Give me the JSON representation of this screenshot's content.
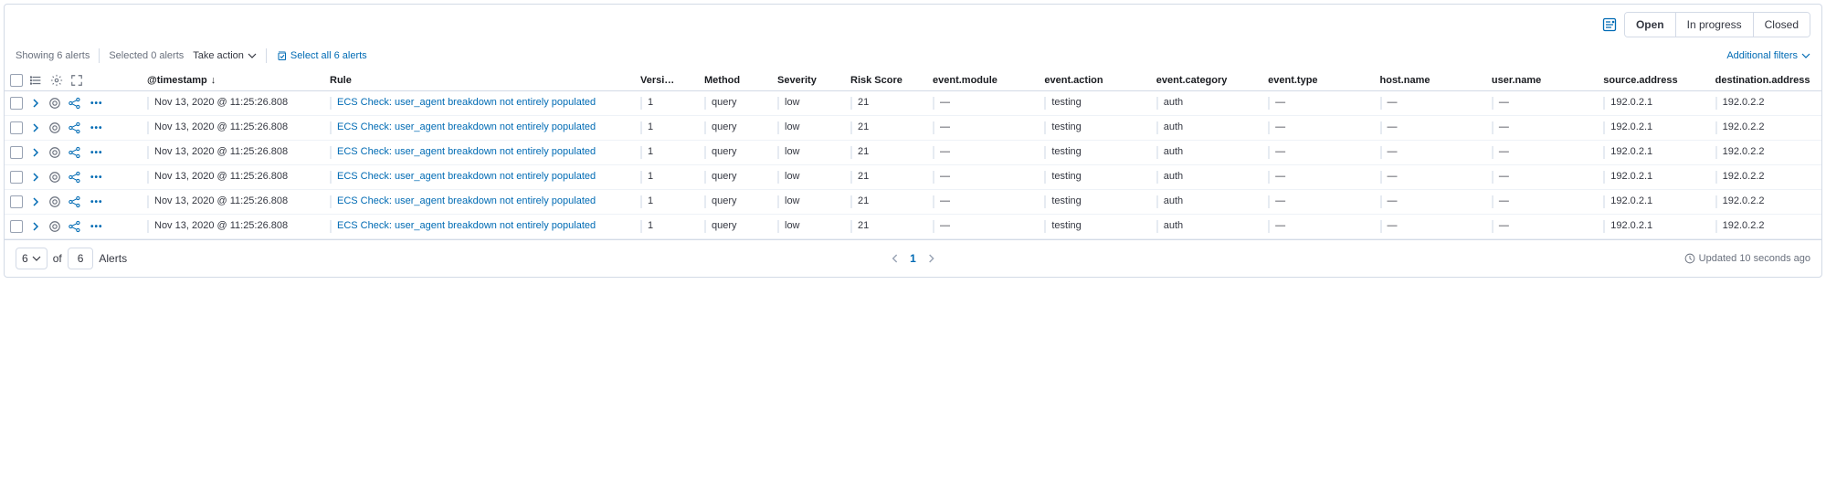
{
  "topbar": {
    "status_open": "Open",
    "status_inprogress": "In progress",
    "status_closed": "Closed"
  },
  "toolbar": {
    "showing": "Showing 6 alerts",
    "selected": "Selected 0 alerts",
    "take_action": "Take action",
    "select_all": "Select all 6 alerts",
    "additional_filters": "Additional filters"
  },
  "columns": {
    "timestamp": "@timestamp",
    "rule": "Rule",
    "version": "Versi…",
    "method": "Method",
    "severity": "Severity",
    "risk_score": "Risk Score",
    "event_module": "event.module",
    "event_action": "event.action",
    "event_category": "event.category",
    "event_type": "event.type",
    "host_name": "host.name",
    "user_name": "user.name",
    "source_address": "source.address",
    "destination_address": "destination.address"
  },
  "rows": [
    {
      "timestamp": "Nov 13, 2020 @ 11:25:26.808",
      "rule": "ECS Check: user_agent breakdown not entirely populated",
      "version": "1",
      "method": "query",
      "severity": "low",
      "risk_score": "21",
      "event_module": "—",
      "event_action": "testing",
      "event_category": "auth",
      "event_type": "—",
      "host_name": "—",
      "user_name": "—",
      "source_address": "192.0.2.1",
      "destination_address": "192.0.2.2"
    },
    {
      "timestamp": "Nov 13, 2020 @ 11:25:26.808",
      "rule": "ECS Check: user_agent breakdown not entirely populated",
      "version": "1",
      "method": "query",
      "severity": "low",
      "risk_score": "21",
      "event_module": "—",
      "event_action": "testing",
      "event_category": "auth",
      "event_type": "—",
      "host_name": "—",
      "user_name": "—",
      "source_address": "192.0.2.1",
      "destination_address": "192.0.2.2"
    },
    {
      "timestamp": "Nov 13, 2020 @ 11:25:26.808",
      "rule": "ECS Check: user_agent breakdown not entirely populated",
      "version": "1",
      "method": "query",
      "severity": "low",
      "risk_score": "21",
      "event_module": "—",
      "event_action": "testing",
      "event_category": "auth",
      "event_type": "—",
      "host_name": "—",
      "user_name": "—",
      "source_address": "192.0.2.1",
      "destination_address": "192.0.2.2"
    },
    {
      "timestamp": "Nov 13, 2020 @ 11:25:26.808",
      "rule": "ECS Check: user_agent breakdown not entirely populated",
      "version": "1",
      "method": "query",
      "severity": "low",
      "risk_score": "21",
      "event_module": "—",
      "event_action": "testing",
      "event_category": "auth",
      "event_type": "—",
      "host_name": "—",
      "user_name": "—",
      "source_address": "192.0.2.1",
      "destination_address": "192.0.2.2"
    },
    {
      "timestamp": "Nov 13, 2020 @ 11:25:26.808",
      "rule": "ECS Check: user_agent breakdown not entirely populated",
      "version": "1",
      "method": "query",
      "severity": "low",
      "risk_score": "21",
      "event_module": "—",
      "event_action": "testing",
      "event_category": "auth",
      "event_type": "—",
      "host_name": "—",
      "user_name": "—",
      "source_address": "192.0.2.1",
      "destination_address": "192.0.2.2"
    },
    {
      "timestamp": "Nov 13, 2020 @ 11:25:26.808",
      "rule": "ECS Check: user_agent breakdown not entirely populated",
      "version": "1",
      "method": "query",
      "severity": "low",
      "risk_score": "21",
      "event_module": "—",
      "event_action": "testing",
      "event_category": "auth",
      "event_type": "—",
      "host_name": "—",
      "user_name": "—",
      "source_address": "192.0.2.1",
      "destination_address": "192.0.2.2"
    }
  ],
  "footer": {
    "page_size": "6",
    "of_label": "of",
    "total": "6",
    "alerts_label": "Alerts",
    "current_page": "1",
    "updated": "Updated 10 seconds ago"
  }
}
